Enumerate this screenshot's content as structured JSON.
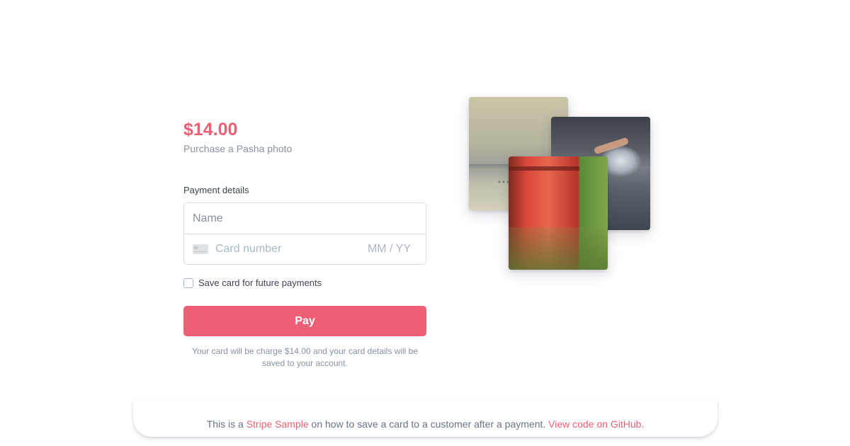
{
  "checkout": {
    "price": "$14.00",
    "product": "Purchase a Pasha photo",
    "payment_label": "Payment details",
    "name_placeholder": "Name",
    "card_placeholder": "Card number",
    "exp_placeholder": "MM / YY",
    "save_card_label": "Save card for future payments",
    "pay_label": "Pay",
    "note": "Your card will be charge $14.00 and your card details will be saved to your account."
  },
  "photos": [
    {
      "name": "lake-photo"
    },
    {
      "name": "dive-photo"
    },
    {
      "name": "barrel-photo"
    }
  ],
  "footer": {
    "prefix": "This is a",
    "link1": "Stripe Sample",
    "middle": "on how to save a card to a customer after a payment.",
    "link2": "View code on GitHub."
  },
  "colors": {
    "accent": "#ed5f74",
    "text": "#3d4351",
    "muted": "#8792a2",
    "border": "#d8dee4"
  },
  "icons": [
    "card-icon"
  ]
}
